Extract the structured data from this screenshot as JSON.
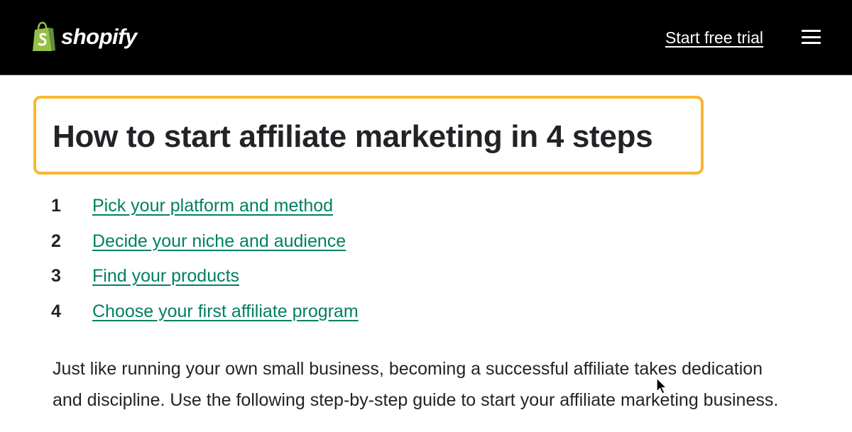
{
  "header": {
    "logo_text": "shopify",
    "trial_link": "Start free trial",
    "menu_icon": "hamburger-menu-icon"
  },
  "article": {
    "heading": "How to start affiliate marketing in 4 steps",
    "steps": [
      {
        "number": "1",
        "label": "Pick your platform and method"
      },
      {
        "number": "2",
        "label": "Decide your niche and audience"
      },
      {
        "number": "3",
        "label": "Find your products"
      },
      {
        "number": "4",
        "label": "Choose your first affiliate program"
      }
    ],
    "intro": "Just like running your own small business, becoming a successful affiliate takes dedication and discipline. Use the following step-by-step guide to start your affiliate marketing business."
  },
  "colors": {
    "header_bg": "#000000",
    "link": "#008060",
    "highlight_border": "#f8b730",
    "logo_green": "#95bf47"
  }
}
